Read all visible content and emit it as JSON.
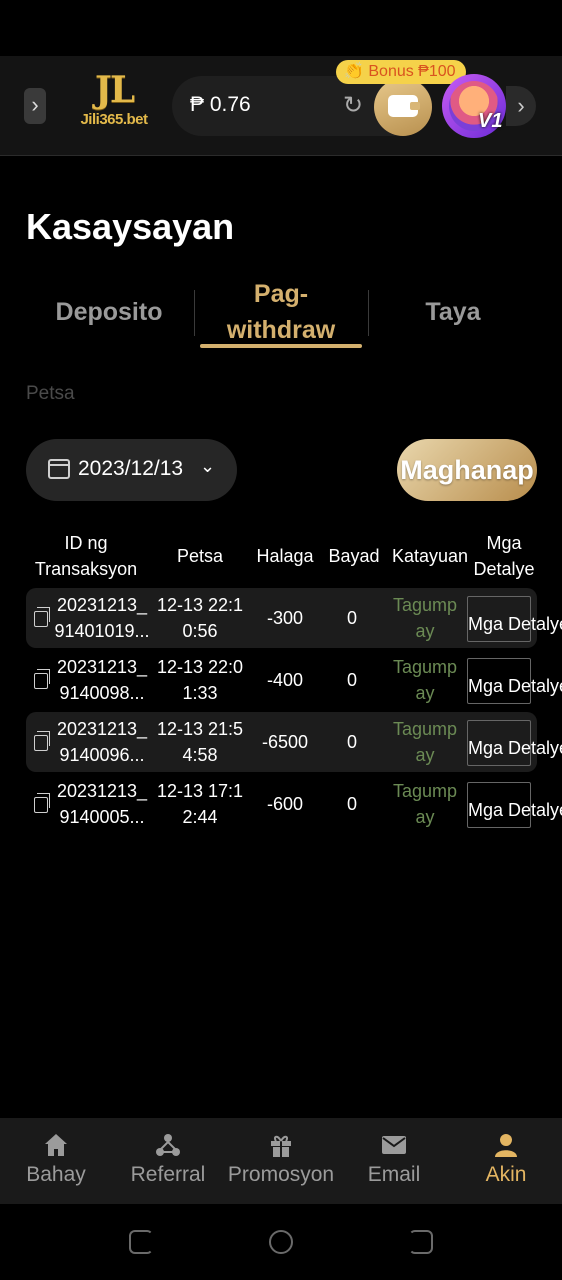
{
  "header": {
    "logo_mark": "JL",
    "logo_text": "Jili365.bet",
    "balance": "₱ 0.76",
    "bonus": "👏 Bonus ₱100",
    "vip": "V1"
  },
  "page_title": "Kasaysayan",
  "tabs": [
    {
      "label": "Deposito",
      "active": false
    },
    {
      "label": "Pag-\nwithdraw",
      "active": true
    },
    {
      "label": "Taya",
      "active": false
    }
  ],
  "filter": {
    "date_label": "Petsa",
    "date_value": "2023/12/13",
    "search_label": "Maghanap"
  },
  "table": {
    "headers": [
      "ID ng Transaksyon",
      "Petsa",
      "Halaga",
      "Bayad",
      "Katayuan",
      "Mga Detalye"
    ],
    "rows": [
      {
        "id": "20231213_ 91401019...",
        "date": "12-13 22:1 0:56",
        "amount": "-300",
        "fee": "0",
        "status": "Tagump ay",
        "detail": "Mga Detalye"
      },
      {
        "id": "20231213_ 9140098...",
        "date": "12-13 22:0 1:33",
        "amount": "-400",
        "fee": "0",
        "status": "Tagump ay",
        "detail": "Mga Detalye"
      },
      {
        "id": "20231213_ 9140096...",
        "date": "12-13 21:5 4:58",
        "amount": "-6500",
        "fee": "0",
        "status": "Tagump ay",
        "detail": "Mga Detalye"
      },
      {
        "id": "20231213_ 9140005...",
        "date": "12-13 17:1 2:44",
        "amount": "-600",
        "fee": "0",
        "status": "Tagump ay",
        "detail": "Mga Detalye"
      }
    ]
  },
  "nav": [
    {
      "label": "Bahay",
      "icon": "home-icon",
      "active": false
    },
    {
      "label": "Referral",
      "icon": "referral-icon",
      "active": false
    },
    {
      "label": "Promosyon",
      "icon": "gift-icon",
      "active": false
    },
    {
      "label": "Email",
      "icon": "mail-icon",
      "active": false
    },
    {
      "label": "Akin",
      "icon": "user-icon",
      "active": true
    }
  ],
  "colors": {
    "accent_gold": "#d4b06e",
    "success_green": "#6b8a54",
    "background": "#000000"
  }
}
